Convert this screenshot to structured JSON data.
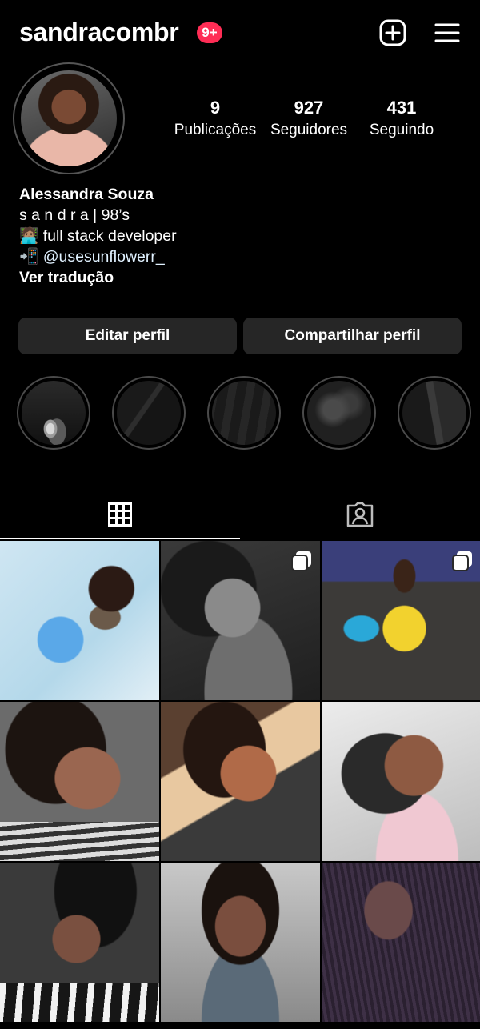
{
  "header": {
    "username": "sandracombr",
    "notification_badge": "9+",
    "new_post_icon": "plus-square-icon",
    "menu_icon": "hamburger-menu-icon"
  },
  "profile": {
    "stats": [
      {
        "value": "9",
        "label": "Publicações"
      },
      {
        "value": "927",
        "label": "Seguidores"
      },
      {
        "value": "431",
        "label": "Seguindo"
      }
    ],
    "name": "Alessandra Souza",
    "bio_lines": [
      "s a n d r a | 98’s",
      "🧑🏽‍💻 full stack developer"
    ],
    "link_prefix": "📲 ",
    "link": "@usesunflowerr_",
    "translate": "Ver tradução"
  },
  "actions": {
    "edit_label": "Editar perfil",
    "share_label": "Compartilhar perfil"
  },
  "tabs": {
    "grid_icon": "grid-icon",
    "tagged_icon": "tagged-person-icon",
    "active": "grid"
  },
  "colors": {
    "background": "#000000",
    "button": "#262626",
    "badge": "#ff2d55",
    "link": "#e0f1ff"
  }
}
